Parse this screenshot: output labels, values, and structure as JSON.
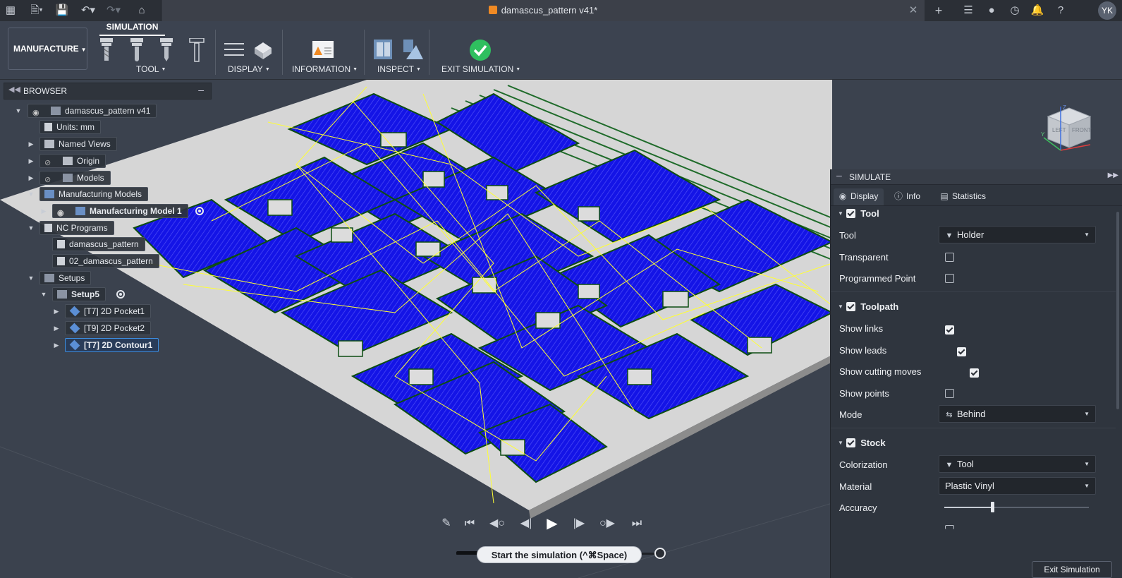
{
  "window": {
    "title": "damascus_pattern v41*",
    "user_initials": "YK"
  },
  "toolbar": {
    "workspace": "MANUFACTURE",
    "active_tab": "SIMULATION",
    "groups": [
      "TOOL",
      "DISPLAY",
      "INFORMATION",
      "INSPECT",
      "EXIT SIMULATION"
    ]
  },
  "browser": {
    "title": "BROWSER",
    "nodes": [
      "damascus_pattern v41",
      "Units: mm",
      "Named Views",
      "Origin",
      "Models",
      "Manufacturing Models",
      "Manufacturing Model 1",
      "NC Programs",
      "damascus_pattern",
      "02_damascus_pattern",
      "Setups",
      "Setup5",
      "[T7] 2D Pocket1",
      "[T9] 2D Pocket2",
      "[T7] 2D Contour1"
    ]
  },
  "viewcube": {
    "faces": [
      "FRONT",
      "LEFT"
    ],
    "axes": [
      "Z",
      "Y"
    ]
  },
  "playback": {
    "tooltip": "Start the simulation (^⌘Space)"
  },
  "simulate": {
    "title": "SIMULATE",
    "tabs": [
      "Display",
      "Info",
      "Statistics"
    ],
    "tool_section": {
      "title": "Tool",
      "enabled": true,
      "tool_label": "Tool",
      "tool_value": "Holder",
      "transparent_label": "Transparent",
      "transparent": false,
      "programmed_point_label": "Programmed Point",
      "programmed_point": false
    },
    "toolpath_section": {
      "title": "Toolpath",
      "enabled": true,
      "show_links_label": "Show links",
      "show_links": true,
      "show_leads_label": "Show leads",
      "show_leads": true,
      "show_cutting_moves_label": "Show cutting moves",
      "show_cutting_moves": true,
      "show_points_label": "Show points",
      "show_points": false,
      "mode_label": "Mode",
      "mode_value": "Behind"
    },
    "stock_section": {
      "title": "Stock",
      "enabled": true,
      "colorization_label": "Colorization",
      "colorization_value": "Tool",
      "material_label": "Material",
      "material_value": "Plastic Vinyl",
      "accuracy_label": "Accuracy",
      "accuracy_level": 0.33
    },
    "exit_button": "Exit Simulation"
  },
  "colors": {
    "toolpath_blue": "#1414e6",
    "toolpath_links": "#ffff33",
    "stock": "#d4d4d4",
    "accent": "#3d8ee0"
  }
}
